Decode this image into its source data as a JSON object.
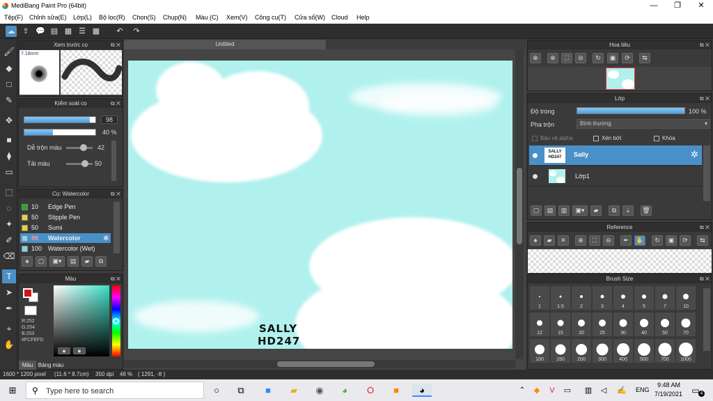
{
  "window": {
    "title": "MediBang Paint Pro (64bit)",
    "controls": [
      "—",
      "❐",
      "✕"
    ]
  },
  "menu": [
    "Tệp(F)",
    "Chỉnh sửa(E)",
    "Lớp(L)",
    "Bộ lọc(R)",
    "Chọn(S)",
    "Chụp(N)",
    "Màu (C)",
    "Xem(V)",
    "Công cụ(T)",
    "Cửa sổ(W)",
    "Cloud",
    "Help"
  ],
  "brush_preview": {
    "title": "Xem trước cọ",
    "size": "7.18mm"
  },
  "brush_control": {
    "title": "Kiểm soát cọ",
    "size_value": "98",
    "opacity_value": "40 %",
    "blend_label": "Dễ trộn màu",
    "blend_value": "42",
    "paint_label": "Tải màu",
    "paint_value": "50",
    "size_fraction": 0.92,
    "opacity_fraction": 0.4,
    "blend_fraction": 0.42,
    "paint_fraction": 0.5
  },
  "brush_list": {
    "title": "Cọ: Watercolor",
    "items": [
      {
        "size": "10",
        "name": "Edge Pen",
        "color": "#22aa22"
      },
      {
        "size": "50",
        "name": "Stipple Pen",
        "color": "#e6d23a"
      },
      {
        "size": "50",
        "name": "Sumi",
        "color": "#e6d23a"
      },
      {
        "size": "98",
        "name": "Watercolor",
        "color": "#7fd8ee",
        "selected": true
      },
      {
        "size": "100",
        "name": "Watercolor (Wet)",
        "color": "#7fd8ee"
      }
    ]
  },
  "color_panel": {
    "title": "Màu",
    "r": "R:252",
    "g": "G:254",
    "b": "B:253",
    "hex": "#FCFEFD",
    "tabs": [
      "Màu",
      "Bảng màu"
    ],
    "primary": "#d0141c",
    "secondary": "#ffffff"
  },
  "canvas": {
    "tab": "Untitled",
    "bg_color": "#b0f1ee",
    "signature_line1": "SALLY",
    "signature_line2": "HD247"
  },
  "navigator": {
    "title": "Hoa tiêu"
  },
  "layers": {
    "title": "Lớp",
    "opacity_label": "Độ trong",
    "opacity_value": "100 %",
    "opacity_fraction": 1.0,
    "blend_label": "Pha trộn",
    "blend_value": "Bình thường",
    "protect_alpha": "Bảo vệ alpha",
    "clipping": "Xén bớt",
    "lock": "Khóa",
    "items": [
      {
        "name": "Sally",
        "thumb": "SALLY HD247",
        "selected": true
      },
      {
        "name": "Lớp1",
        "thumb": "",
        "selected": false
      }
    ]
  },
  "reference": {
    "title": "Reference"
  },
  "brush_size": {
    "title": "Brush Size",
    "sizes": [
      "1",
      "1.5",
      "2",
      "3",
      "4",
      "5",
      "7",
      "10",
      "12",
      "15",
      "20",
      "25",
      "30",
      "40",
      "50",
      "70",
      "100",
      "150",
      "200",
      "300",
      "400",
      "500",
      "700",
      "1000"
    ]
  },
  "status": {
    "dimensions": "1600 * 1200 pixel",
    "physical": "(11.6 * 8.7cm)",
    "dpi": "350 dpi",
    "zoom": "46 %",
    "cursor": "( 1291, -8 )"
  },
  "taskbar": {
    "search_placeholder": "Type here to search",
    "lang": "ENG",
    "time": "9:48 AM",
    "date": "7/19/2021",
    "notif_count": "4"
  }
}
